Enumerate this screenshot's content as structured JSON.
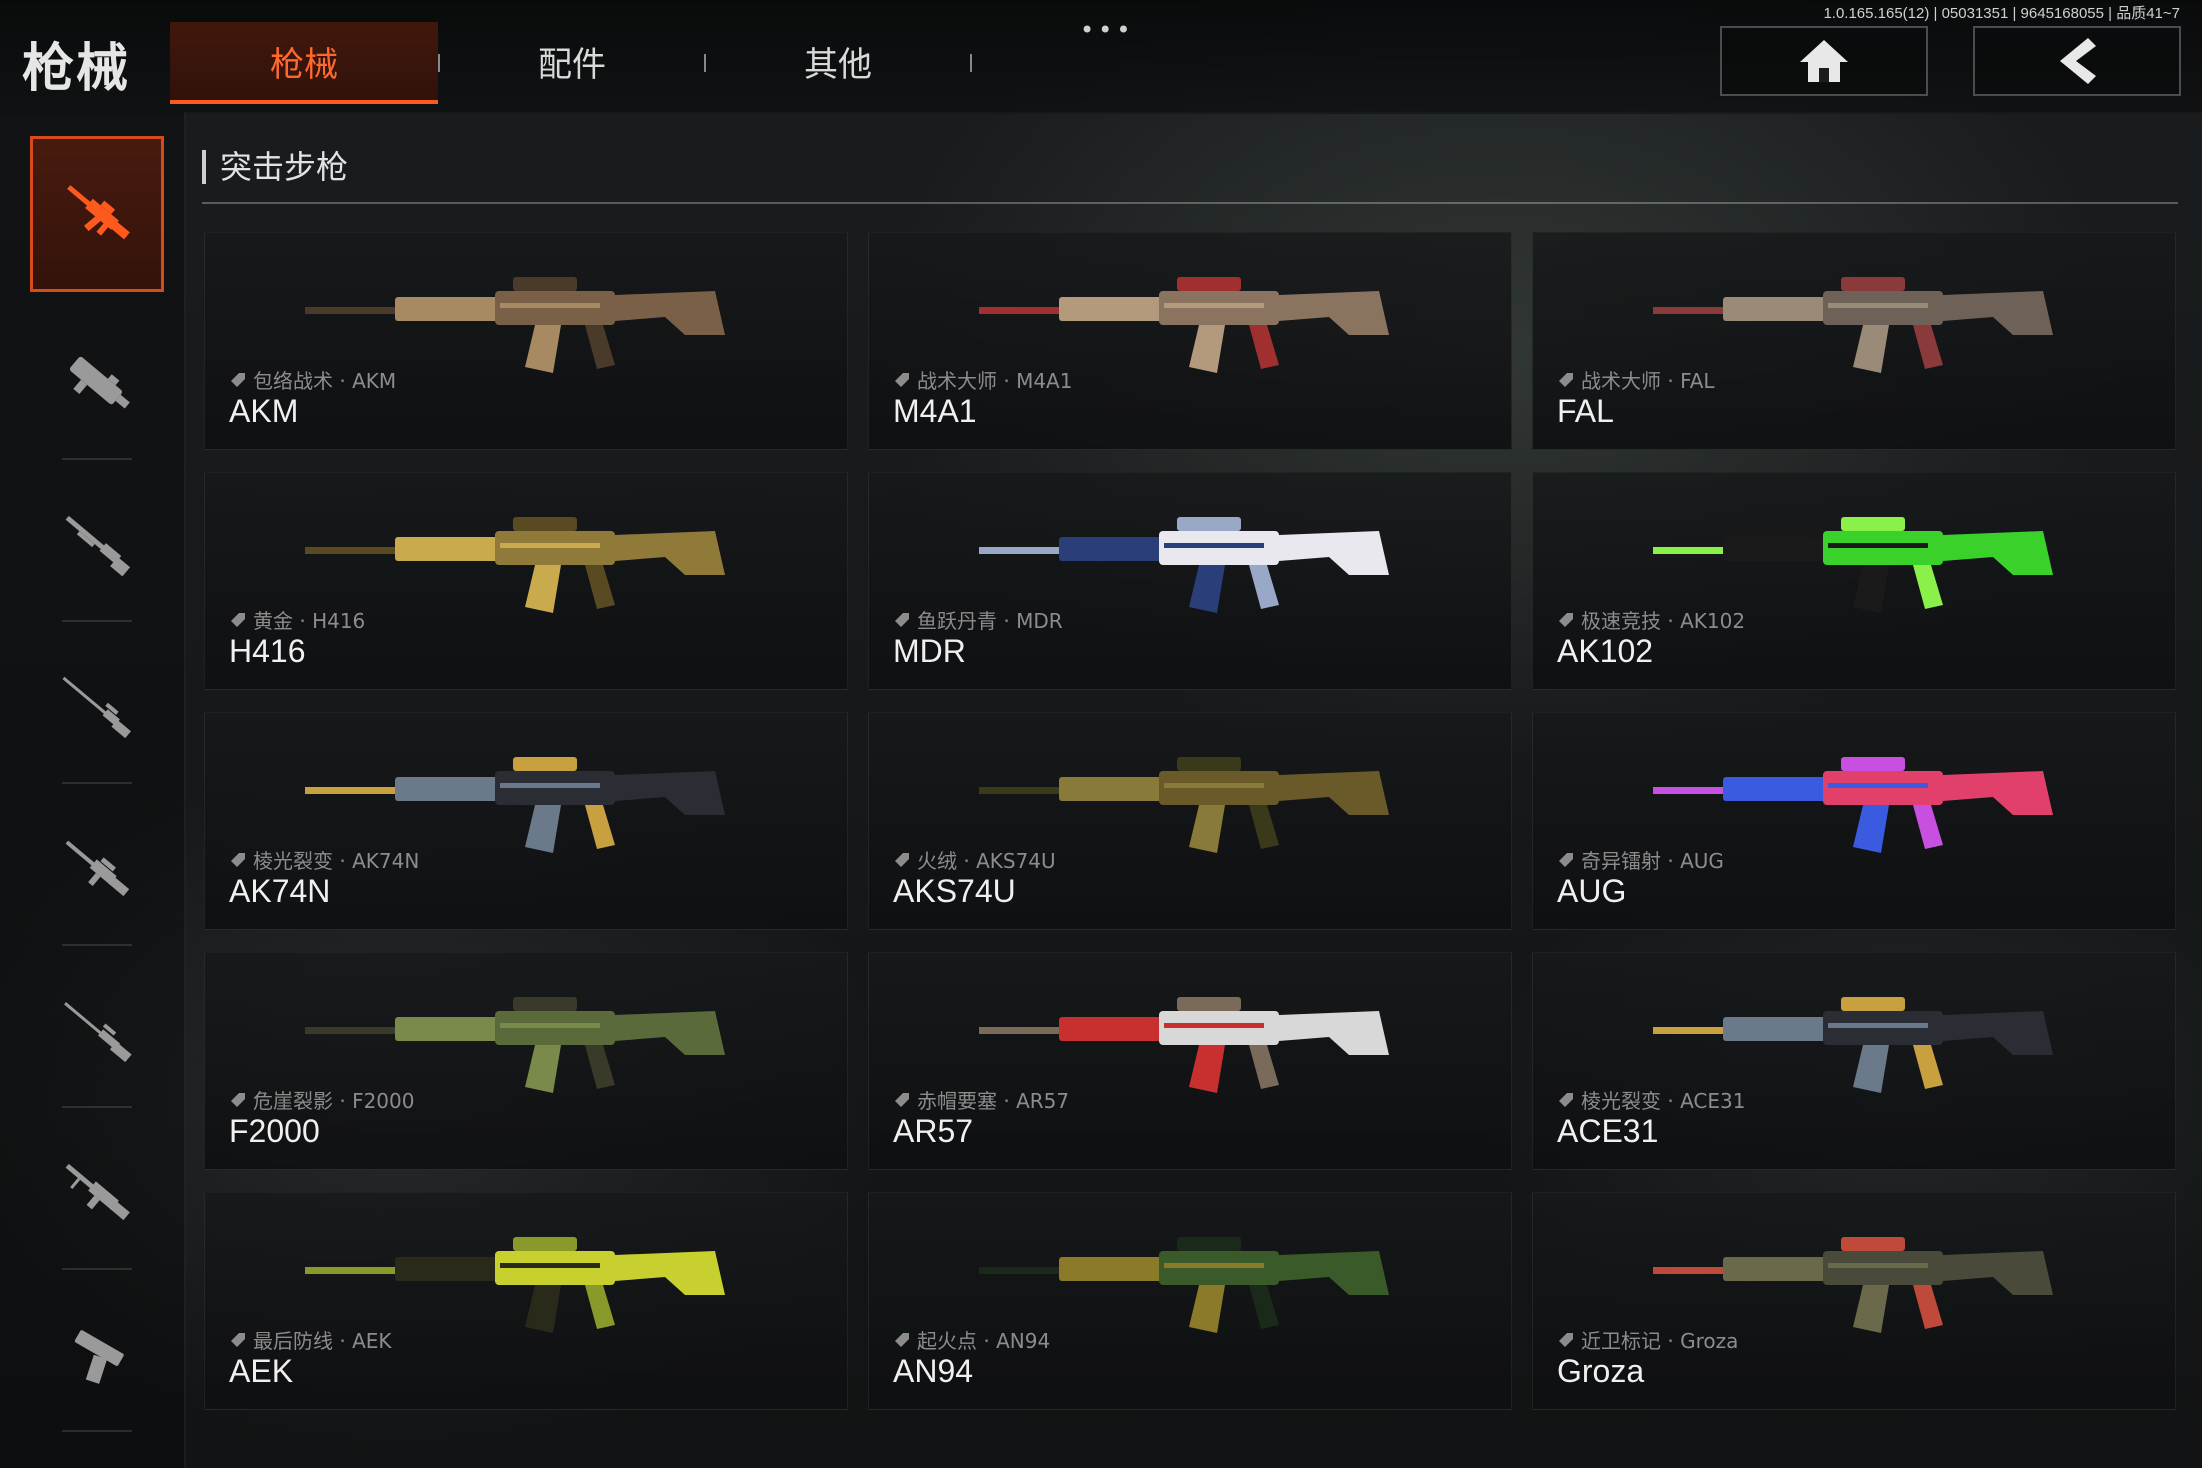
{
  "header": {
    "title": "枪械",
    "tabs": [
      {
        "label": "枪械",
        "active": true
      },
      {
        "label": "配件",
        "active": false
      },
      {
        "label": "其他",
        "active": false
      }
    ],
    "more": "•••",
    "version": "1.0.165.165(12) | 05031351 | 9645168055 | 品质41~7",
    "home_icon": "home-icon",
    "back_icon": "chevron-left-icon"
  },
  "sidebar": {
    "categories": [
      {
        "icon": "assault-rifle-icon",
        "active": true
      },
      {
        "icon": "smg-icon",
        "active": false
      },
      {
        "icon": "shotgun-icon",
        "active": false
      },
      {
        "icon": "sniper-rifle-icon",
        "active": false
      },
      {
        "icon": "dmr-icon",
        "active": false
      },
      {
        "icon": "bolt-rifle-icon",
        "active": false
      },
      {
        "icon": "lmg-icon",
        "active": false
      },
      {
        "icon": "pistol-icon",
        "active": false
      }
    ]
  },
  "section": {
    "title": "突击步枪"
  },
  "weapons": [
    {
      "skin": "包络战术 · AKM",
      "name": "AKM",
      "colors": [
        "#7a6046",
        "#a88a62",
        "#4a3a2a"
      ]
    },
    {
      "skin": "战术大师 · M4A1",
      "name": "M4A1",
      "colors": [
        "#8a7460",
        "#b39a7c",
        "#a03030"
      ]
    },
    {
      "skin": "战术大师 · FAL",
      "name": "FAL",
      "colors": [
        "#6e6258",
        "#9a8a78",
        "#8a3a3a"
      ]
    },
    {
      "skin": "黄金 · H416",
      "name": "H416",
      "colors": [
        "#8f7a3a",
        "#c9aa4c",
        "#5a4a22"
      ]
    },
    {
      "skin": "鱼跃丹青 · MDR",
      "name": "MDR",
      "colors": [
        "#e8e8ee",
        "#2a3f7a",
        "#9aa8c8"
      ]
    },
    {
      "skin": "极速竞技 · AK102",
      "name": "AK102",
      "colors": [
        "#3ad12a",
        "#1a1a1a",
        "#8af04a"
      ]
    },
    {
      "skin": "棱光裂变 · AK74N",
      "name": "AK74N",
      "colors": [
        "#2a2d33",
        "#6a7a8a",
        "#c8a040"
      ]
    },
    {
      "skin": "火绒 · AKS74U",
      "name": "AKS74U",
      "colors": [
        "#6a5a2a",
        "#8a7a3a",
        "#3a3a1a"
      ]
    },
    {
      "skin": "奇异镭射 · AUG",
      "name": "AUG",
      "colors": [
        "#e0406a",
        "#3a5ae0",
        "#c850e0"
      ]
    },
    {
      "skin": "危崖裂影 · F2000",
      "name": "F2000",
      "colors": [
        "#5a6a3a",
        "#7a8a4a",
        "#3a3a2a"
      ]
    },
    {
      "skin": "赤帽要塞 · AR57",
      "name": "AR57",
      "colors": [
        "#d8d8d8",
        "#c83030",
        "#7a6a5a"
      ]
    },
    {
      "skin": "棱光裂变 · ACE31",
      "name": "ACE31",
      "colors": [
        "#2a2d33",
        "#6a7a8a",
        "#c8a040"
      ]
    },
    {
      "skin": "最后防线 · AEK",
      "name": "AEK",
      "colors": [
        "#c8d030",
        "#2a2a1a",
        "#8a9a2a"
      ]
    },
    {
      "skin": "起火点 · AN94",
      "name": "AN94",
      "colors": [
        "#3a5a2a",
        "#8a7a2a",
        "#1a2a1a"
      ]
    },
    {
      "skin": "近卫标记 · Groza",
      "name": "Groza",
      "colors": [
        "#4a4a3a",
        "#6a6a4a",
        "#c04a3a"
      ]
    }
  ]
}
